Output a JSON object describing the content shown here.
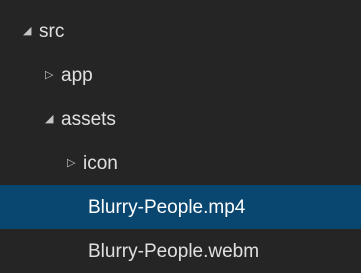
{
  "explorer": {
    "items": [
      {
        "label": "src",
        "state": "expanded",
        "twisty": "◢",
        "selected": false
      },
      {
        "label": "app",
        "state": "collapsed",
        "twisty": "▷",
        "selected": false
      },
      {
        "label": "assets",
        "state": "expanded",
        "twisty": "◢",
        "selected": false
      },
      {
        "label": "icon",
        "state": "collapsed",
        "twisty": "▷",
        "selected": false
      },
      {
        "label": "Blurry-People.mp4",
        "state": "file",
        "twisty": "",
        "selected": true
      },
      {
        "label": "Blurry-People.webm",
        "state": "file",
        "twisty": "",
        "selected": false
      }
    ],
    "colors": {
      "background": "#252526",
      "selection": "#094771",
      "text": "#e0e0e0"
    }
  }
}
